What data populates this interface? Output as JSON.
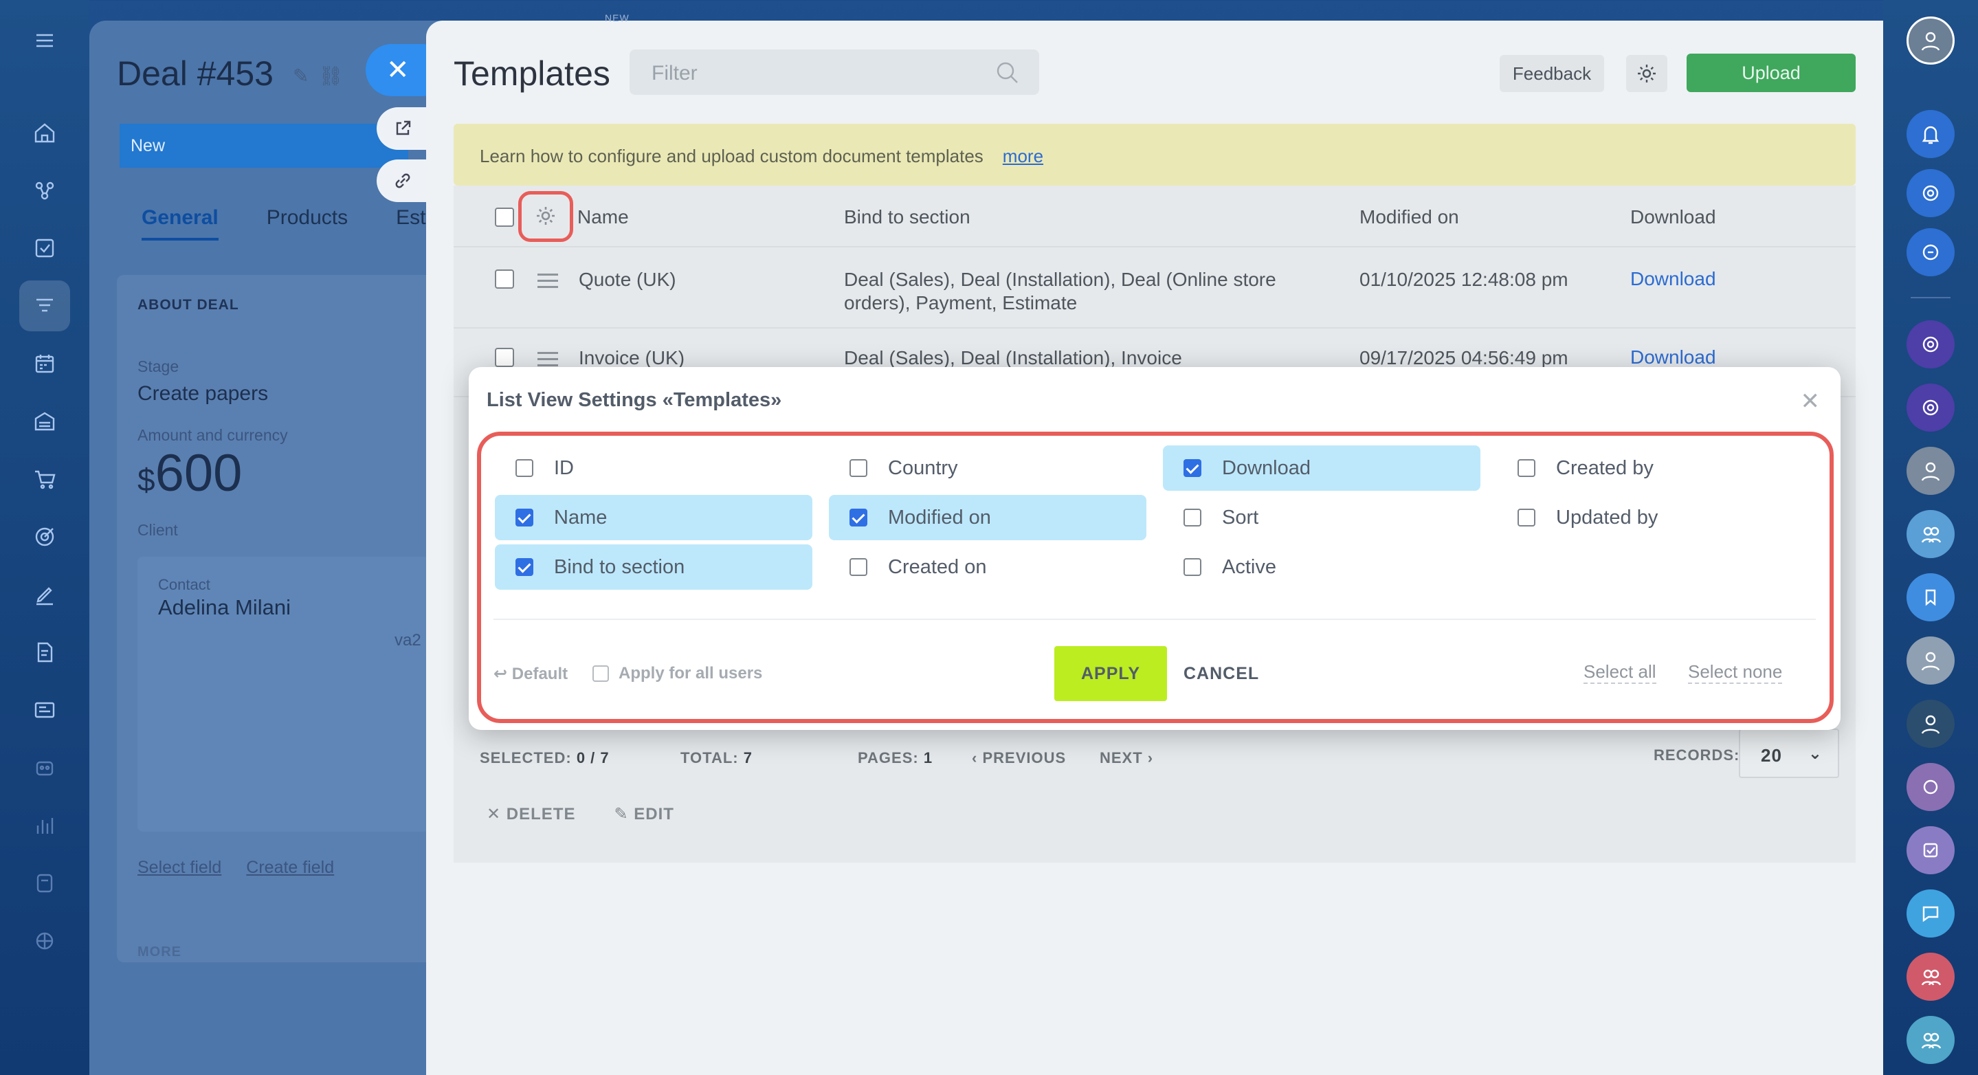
{
  "left_sidebar": {
    "icons": [
      "menu-icon",
      "home-icon",
      "crm-icon",
      "tasks-icon",
      "funnel-icon",
      "calendar-icon",
      "storage-icon",
      "cart-icon",
      "target-icon",
      "sign-icon",
      "document-icon",
      "contact-center-icon",
      "robot-icon",
      "analytics-icon",
      "marketplace-icon",
      "settings-icon"
    ]
  },
  "deal": {
    "title": "Deal #453",
    "stage_bar": "New",
    "tabs": [
      "General",
      "Products",
      "Est"
    ],
    "about_title": "ABOUT DEAL",
    "stage_label": "Stage",
    "stage_value": "Create papers",
    "amount_label": "Amount and currency",
    "currency": "$",
    "amount": "600",
    "client_label": "Client",
    "contact_label": "Contact",
    "contact_name": "Adelina Milani",
    "contact_suffix": "va2",
    "select_field": "Select field",
    "create_field": "Create field",
    "more_label": "MORE"
  },
  "panel": {
    "new_tag": "NEW",
    "title": "Templates",
    "filter_placeholder": "Filter",
    "feedback": "Feedback",
    "upload": "Upload",
    "info_text": "Learn how to configure and upload custom document templates",
    "info_link": "more",
    "columns": [
      "Name",
      "Bind to section",
      "Modified on",
      "Download"
    ],
    "rows": [
      {
        "name": "Quote (UK)",
        "section_line1": "Deal (Sales), Deal (Installation), Deal (Online store",
        "section_line2": "orders), Payment, Estimate",
        "modified": "01/10/2025 12:48:08 pm",
        "download": "Download"
      },
      {
        "name": "Invoice (UK)",
        "section_line1": "Deal (Sales), Deal (Installation), Invoice",
        "section_line2": "",
        "modified": "09/17/2025 04:56:49 pm",
        "download": "Download"
      }
    ],
    "footer": {
      "selected_label": "SELECTED:",
      "selected_value": "0 / 7",
      "total_label": "TOTAL:",
      "total_value": "7",
      "pages_label": "PAGES:",
      "pages_value": "1",
      "previous": "PREVIOUS",
      "next": "NEXT",
      "records_label": "RECORDS:",
      "records_value": "20"
    },
    "actions": {
      "delete": "DELETE",
      "edit": "EDIT"
    }
  },
  "modal": {
    "title": "List View Settings «Templates»",
    "options": [
      {
        "label": "ID",
        "checked": false
      },
      {
        "label": "Country",
        "checked": false
      },
      {
        "label": "Download",
        "checked": true
      },
      {
        "label": "Created by",
        "checked": false
      },
      {
        "label": "Name",
        "checked": true
      },
      {
        "label": "Modified on",
        "checked": true
      },
      {
        "label": "Sort",
        "checked": false
      },
      {
        "label": "Updated by",
        "checked": false
      },
      {
        "label": "Bind to section",
        "checked": true
      },
      {
        "label": "Created on",
        "checked": false
      },
      {
        "label": "Active",
        "checked": false
      }
    ],
    "default_label": "Default",
    "apply_all_label": "Apply for all users",
    "apply": "APPLY",
    "cancel": "CANCEL",
    "select_all": "Select all",
    "select_none": "Select none"
  },
  "colors": {
    "accent_blue": "#2f6fe4",
    "checked_row": "#bde8fb",
    "apply_green": "#bbed21",
    "upload_green": "#3fa85c",
    "highlight_red": "#e85d59"
  }
}
